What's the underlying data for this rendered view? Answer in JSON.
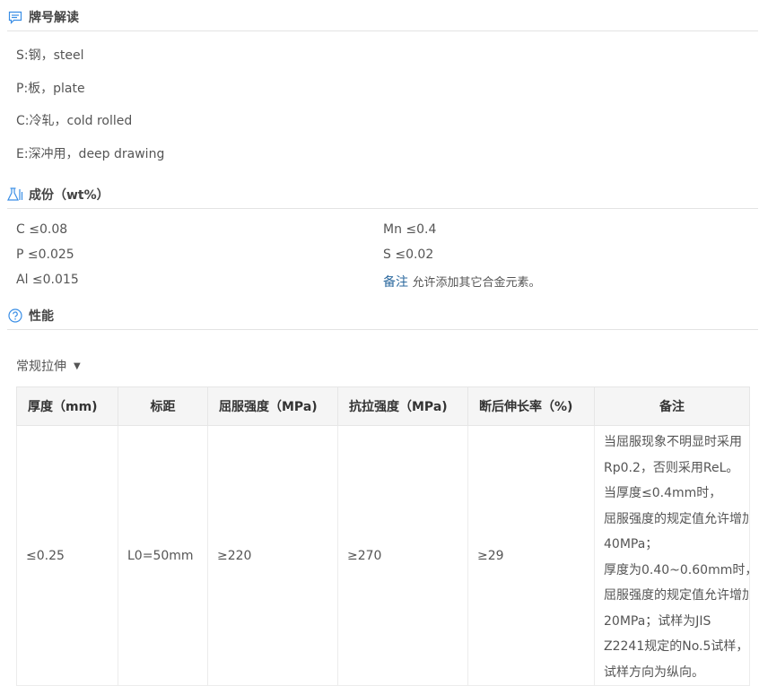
{
  "sections": {
    "decode": {
      "title": "牌号解读",
      "icon": "comment-icon",
      "lines": [
        "S:钢，steel",
        "P:板，plate",
        "C:冷轧，cold rolled",
        "E:深冲用，deep drawing"
      ]
    },
    "composition": {
      "title": "成份（wt%）",
      "icon": "flask-icon",
      "left": [
        "C ≤0.08",
        "P ≤0.025",
        "Al ≤0.015"
      ],
      "right": [
        "Mn ≤0.4",
        "S ≤0.02"
      ],
      "note_label": "备注",
      "note_text": "允许添加其它合金元素。"
    },
    "properties": {
      "title": "性能",
      "icon": "question-circle-icon",
      "dropdown_label": "常规拉伸",
      "table": {
        "headers": [
          "厚度（mm)",
          "标距",
          "屈服强度（MPa)",
          "抗拉强度（MPa)",
          "断后伸长率（%)",
          "备注"
        ],
        "rows": [
          {
            "thickness": "≤0.25",
            "gauge": "L0=50mm",
            "yield": "≥220",
            "tensile": "≥270",
            "elongation": "≥29",
            "note_lines": [
              "当屈服现象不明显时采用",
              "Rp0.2，否则采用ReL。",
              "当厚度≤0.4mm时，",
              "屈服强度的规定值允许增加",
              "40MPa；",
              "厚度为0.40~0.60mm时，",
              "屈服强度的规定值允许增加",
              "20MPa；试样为JIS",
              "Z2241规定的No.5试样，",
              "试样方向为纵向。"
            ]
          }
        ]
      }
    }
  },
  "colors": {
    "accent": "#3a8ee6",
    "label_blue": "#2d6a9f"
  }
}
